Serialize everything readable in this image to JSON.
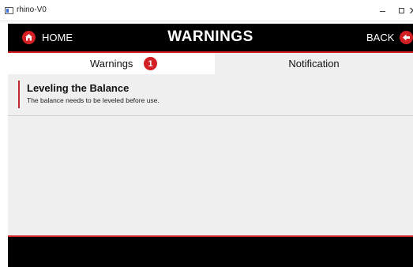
{
  "window": {
    "title": "rhino-V0",
    "minimize_glyph": "–",
    "maximize_glyph": "☐",
    "close_glyph": "✕"
  },
  "header": {
    "home_label": "HOME",
    "title": "WARNINGS",
    "back_label": "BACK",
    "home_icon": "home-icon",
    "back_icon": "back-arrow-icon"
  },
  "tabs": [
    {
      "label": "Warnings",
      "badge": "1",
      "active": true
    },
    {
      "label": "Notification",
      "active": false
    }
  ],
  "warnings": [
    {
      "title": "Leveling the Balance",
      "message": "The balance needs to be leveled before use."
    }
  ],
  "colors": {
    "accent": "#d32025",
    "header_bg": "#000000",
    "panel_bg": "#efefef"
  }
}
